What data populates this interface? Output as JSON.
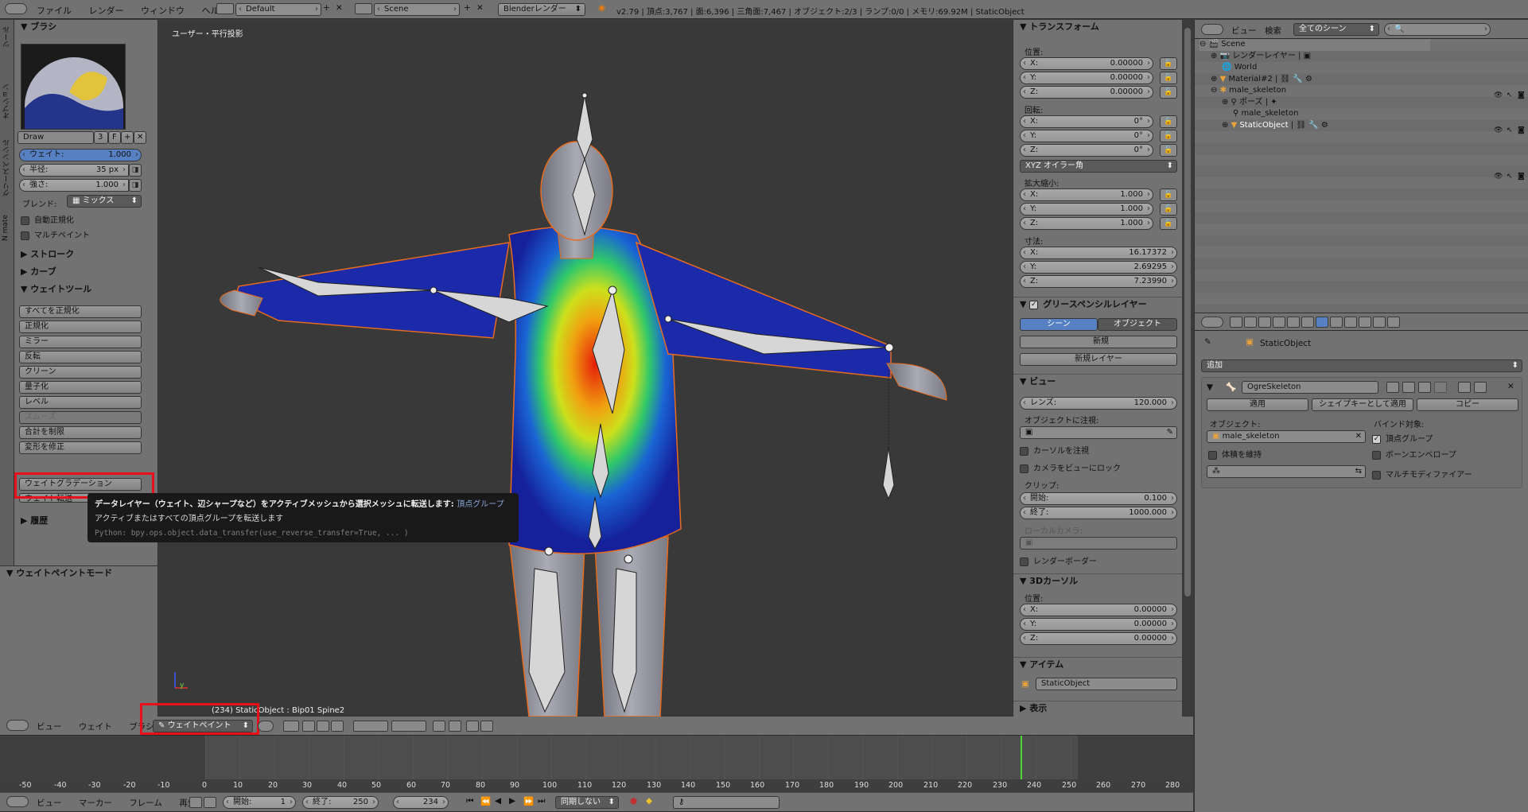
{
  "topbar": {
    "menus": [
      "ファイル",
      "レンダー",
      "ウィンドウ",
      "ヘルプ"
    ],
    "layout": "Default",
    "scene": "Scene",
    "engine": "Blenderレンダー",
    "stats": "v2.79 | 頂点:3,767 | 面:6,396 | 三角面:7,467 | オブジェクト:2/3 | ランプ:0/0 | メモリ:69.92M | StaticObject"
  },
  "toolbar": {
    "tabs": [
      "ツール",
      "オプション",
      "グリースペンシル",
      "N mate"
    ],
    "brush_header": "ブラシ",
    "brush_name": "Draw",
    "brush_users": "3",
    "brush_fake": "F",
    "weight_label": "ウェイト:",
    "weight_value": "1.000",
    "radius_label": "半径:",
    "radius_value": "35 px",
    "strength_label": "強さ:",
    "strength_value": "1.000",
    "blend_label": "ブレンド:",
    "blend_value": "ミックス",
    "auto_normalize": "自動正規化",
    "multipaint": "マルチペイント",
    "stroke": "ストローク",
    "curve": "カーブ",
    "weight_tools": "ウェイトツール",
    "tools": [
      "すべてを正規化",
      "正規化",
      "ミラー",
      "反転",
      "クリーン",
      "量子化",
      "レベル",
      "スムーズ",
      "合計を制限",
      "変形を修正",
      "ウェイトグラデーション",
      "ウェイト転送"
    ],
    "history": "履歴",
    "mode_panel": "ウェイトペイントモード"
  },
  "viewport": {
    "label": "ユーザー・平行投影",
    "object_info": "(234) StaticObject : Bip01 Spine2",
    "axis_y": "y"
  },
  "tooltip": {
    "line1": "データレイヤー（ウェイト、辺シャープなど）をアクティブメッシュから選択メッシュに転送します:",
    "line1_tag": "頂点グループ",
    "line2": "アクティブまたはすべての頂点グループを転送します",
    "line3": "Python: bpy.ops.object.data_transfer(use_reverse_transfer=True, ... )"
  },
  "view3d_header": {
    "menus": [
      "ビュー",
      "ウェイト",
      "ブラシ"
    ],
    "mode": "ウェイトペイント"
  },
  "properties_n": {
    "transform": "トランスフォーム",
    "location": "位置:",
    "loc": [
      {
        "l": "X:",
        "v": "0.00000"
      },
      {
        "l": "Y:",
        "v": "0.00000"
      },
      {
        "l": "Z:",
        "v": "0.00000"
      }
    ],
    "rotation": "回転:",
    "rot": [
      {
        "l": "X:",
        "v": "0°"
      },
      {
        "l": "Y:",
        "v": "0°"
      },
      {
        "l": "Z:",
        "v": "0°"
      }
    ],
    "rot_mode": "XYZ オイラー角",
    "scale": "拡大縮小:",
    "scl": [
      {
        "l": "X:",
        "v": "1.000"
      },
      {
        "l": "Y:",
        "v": "1.000"
      },
      {
        "l": "Z:",
        "v": "1.000"
      }
    ],
    "dimensions": "寸法:",
    "dim": [
      {
        "l": "X:",
        "v": "16.17372"
      },
      {
        "l": "Y:",
        "v": "2.69295"
      },
      {
        "l": "Z:",
        "v": "7.23990"
      }
    ],
    "gp_layer": "グリースペンシルレイヤー",
    "gp_scene": "シーン",
    "gp_object": "オブジェクト",
    "gp_new": "新規",
    "gp_new_layer": "新規レイヤー",
    "view": "ビュー",
    "lens_label": "レンズ:",
    "lens_value": "120.000",
    "lock_object": "オブジェクトに注視:",
    "lock_cursor": "カーソルを注視",
    "lock_camera": "カメラをビューにロック",
    "clip": "クリップ:",
    "clip_start_l": "開始:",
    "clip_start_v": "0.100",
    "clip_end_l": "終了:",
    "clip_end_v": "1000.000",
    "local_camera": "ローカルカメラ:",
    "render_border": "レンダーボーダー",
    "cursor3d": "3Dカーソル",
    "cursor_loc": "位置:",
    "cur": [
      {
        "l": "X:",
        "v": "0.00000"
      },
      {
        "l": "Y:",
        "v": "0.00000"
      },
      {
        "l": "Z:",
        "v": "0.00000"
      }
    ],
    "item": "アイテム",
    "item_name": "StaticObject",
    "display": "表示"
  },
  "outliner": {
    "menus": [
      "ビュー",
      "検索"
    ],
    "scenes": "全てのシーン",
    "rows": [
      {
        "name": "Scene",
        "indent": 0
      },
      {
        "name": "レンダーレイヤー",
        "indent": 1
      },
      {
        "name": "World",
        "indent": 1
      },
      {
        "name": "Material#2",
        "indent": 1
      },
      {
        "name": "male_skeleton",
        "indent": 1
      },
      {
        "name": "ポーズ",
        "indent": 2
      },
      {
        "name": "male_skeleton",
        "indent": 2
      },
      {
        "name": "StaticObject",
        "indent": 2
      }
    ]
  },
  "modifier": {
    "breadcrumb": "StaticObject",
    "add": "追加",
    "name": "OgreSkeleton",
    "apply": "適用",
    "apply_shape": "シェイプキーとして適用",
    "copy": "コピー",
    "object_label": "オブジェクト:",
    "object_value": "male_skeleton",
    "preserve_volume": "体積を維持",
    "bind_to": "バインド対象:",
    "vertex_groups": "頂点グループ",
    "bone_envelopes": "ボーンエンベロープ",
    "multi_modifier": "マルチモディファイアー"
  },
  "timeline": {
    "ticks": [
      "-50",
      "-40",
      "-30",
      "-20",
      "-10",
      "0",
      "10",
      "20",
      "30",
      "40",
      "50",
      "60",
      "70",
      "80",
      "90",
      "100",
      "110",
      "120",
      "130",
      "140",
      "150",
      "160",
      "170",
      "180",
      "190",
      "200",
      "210",
      "220",
      "230",
      "240",
      "250",
      "260",
      "270",
      "280"
    ],
    "menus": [
      "ビュー",
      "マーカー",
      "フレーム",
      "再生"
    ],
    "start_label": "開始:",
    "start_value": "1",
    "end_label": "終了:",
    "end_value": "250",
    "current": "234",
    "sync": "同期しない"
  },
  "colors": {
    "highlight_box": "#e8101a",
    "accent_blue": "#5680c2",
    "outline": "#e86b1e"
  }
}
